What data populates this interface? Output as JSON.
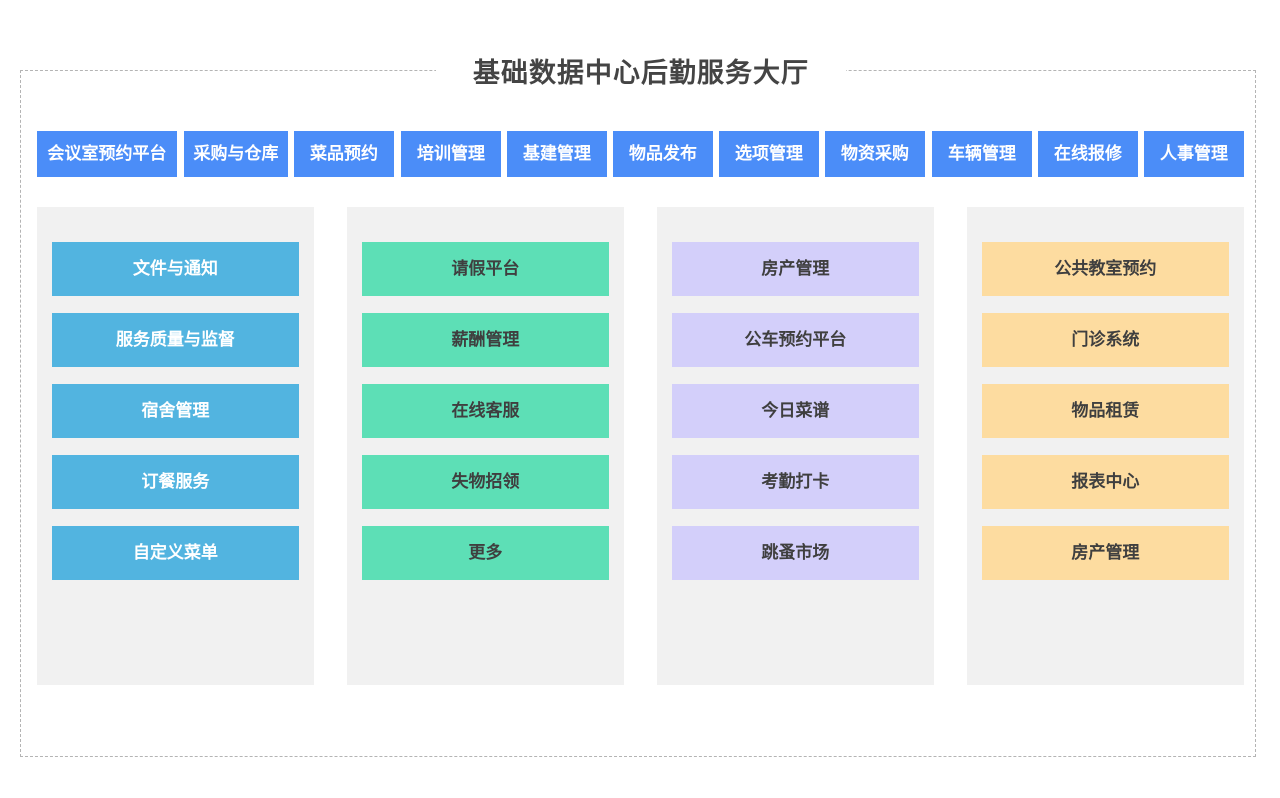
{
  "title": "基础数据中心后勤服务大厅",
  "colors": {
    "nav_bg": "#4b8df8",
    "panel_bg": "#f1f1f1",
    "col1_tile": "#52b4e0",
    "col2_tile": "#5ddfb6",
    "col3_tile": "#d3cffa",
    "col4_tile": "#fddca0"
  },
  "nav": [
    "会议室预约平台",
    "采购与仓库",
    "菜品预约",
    "培训管理",
    "基建管理",
    "物品发布",
    "选项管理",
    "物资采购",
    "车辆管理",
    "在线报修",
    "人事管理"
  ],
  "columns": [
    {
      "items": [
        "文件与通知",
        "服务质量与监督",
        "宿舍管理",
        "订餐服务",
        "自定义菜单"
      ]
    },
    {
      "items": [
        "请假平台",
        "薪酬管理",
        "在线客服",
        "失物招领",
        "更多"
      ]
    },
    {
      "items": [
        "房产管理",
        "公车预约平台",
        "今日菜谱",
        "考勤打卡",
        "跳蚤市场"
      ]
    },
    {
      "items": [
        "公共教室预约",
        "门诊系统",
        "物品租赁",
        "报表中心",
        "房产管理"
      ]
    }
  ]
}
